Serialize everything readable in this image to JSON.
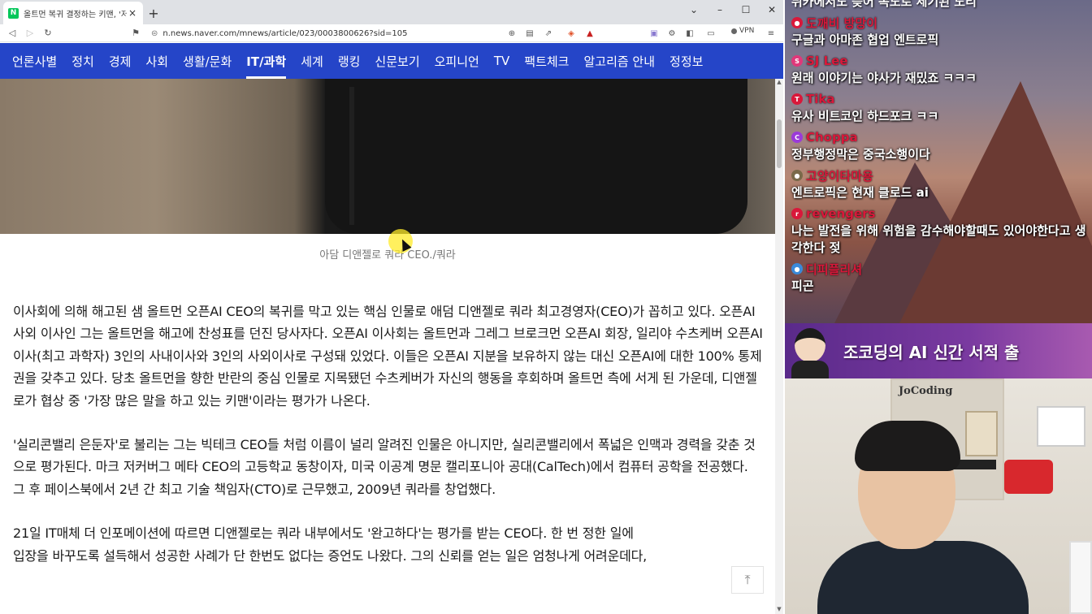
{
  "browser": {
    "tab": {
      "favicon": "N",
      "title": "올트먼 복귀 결정하는 키맨, '저커",
      "close_icon": "×"
    },
    "new_tab_icon": "+",
    "window_controls": [
      "⌄",
      "–",
      "☐",
      "✕"
    ],
    "url": "n.news.naver.com/mnews/article/023/0003800626?sid=105",
    "vpn_label": "VPN"
  },
  "naver_nav": {
    "items": [
      "언론사별",
      "정치",
      "경제",
      "사회",
      "생활/문화",
      "IT/과학",
      "세계",
      "랭킹",
      "신문보기",
      "오피니언",
      "TV",
      "팩트체크",
      "알고리즘 안내",
      "정정보"
    ],
    "active": "IT/과학"
  },
  "article": {
    "caption": "아담 디앤젤로 쿼라 CEO./쿼라",
    "paragraphs": [
      "이사회에 의해 해고된 샘 올트먼 오픈AI CEO의 복귀를 막고 있는 핵심 인물로 애덤 디앤젤로 쿼라 최고경영자(CEO)가 꼽히고 있다. 오픈AI 사외 이사인 그는 올트먼을 해고에 찬성표를 던진 당사자다. 오픈AI 이사회는 올트먼과 그레그 브로크먼 오픈AI 회장, 일리야 수츠케버 오픈AI 이사(최고 과학자) 3인의 사내이사와 3인의 사외이사로 구성돼 있었다. 이들은 오픈AI 지분을 보유하지 않는 대신 오픈AI에 대한 100% 통제권을 갖추고 있다. 당초 올트먼을 향한 반란의 중심 인물로 지목됐던 수츠케버가 자신의 행동을 후회하며 올트먼 측에 서게 된 가운데, 디앤젤로가 협상 중 '가장 많은 말을 하고 있는 키맨'이라는 평가가 나온다.",
      "'실리콘밸리 은둔자'로 불리는 그는 빅테크 CEO들 처럼 이름이 널리 알려진 인물은 아니지만, 실리콘밸리에서 폭넓은 인맥과 경력을 갖춘 것으로 평가된다. 마크 저커버그 메타 CEO의 고등학교 동창이자, 미국 이공계 명문 캘리포니아 공대(CalTech)에서 컴퓨터 공학을 전공했다. 그 후 페이스북에서 2년 간 최고 기술 책임자(CTO)로 근무했고, 2009년 쿼라를 창업했다.",
      "21일 IT매체 더 인포메이션에 따르면 디앤젤로는 쿼라 내부에서도 '완고하다'는 평가를 받는 CEO다. 한 번 정한 일에",
      "입장을 바꾸도록 설득해서 성공한 사례가 단 한번도 없다는 증언도 나왔다. 그의 신뢰를 얻는 일은 엄청나게 어려운데다,"
    ],
    "to_top_icon": "⤒"
  },
  "stream": {
    "chat_top_cut": "뒤카에서도 늦어 목도로 세기된 노리",
    "chat": [
      {
        "name": "도깨비 방망이",
        "text": "구글과 아마존 협업 엔트로픽",
        "avatar_color": "#d9183a"
      },
      {
        "name": "SJ Lee",
        "text": "원래 이야기는 야사가 재밌죠 ㅋㅋㅋ",
        "avatar_color": "#e0387a"
      },
      {
        "name": "Tika",
        "text": "유사 비트코인 하드포크 ㅋㅋ",
        "avatar_color": "#d9183a"
      },
      {
        "name": "Choppa",
        "text": "정부행정막은 중국소행이다",
        "avatar_color": "#9b3ad9"
      },
      {
        "name": "고양이타마용",
        "text": "엔트로픽은 현재 클로드 ai",
        "avatar_color": "#7a6a4a"
      },
      {
        "name": "revengers",
        "text": "나는 발전을 위해 위험을 감수해야할때도 있어야한다고 생각한다 젖",
        "avatar_color": "#d9183a"
      },
      {
        "name": "디피플리셔",
        "text": "피곤",
        "avatar_color": "#3a8ad9"
      }
    ],
    "banner_text": "조코딩의 AI 신간 서적 출",
    "webcam_logo": "JoCoding"
  },
  "colors": {
    "naver_blue": "#2545c8",
    "chat_name_red": "#d9183a",
    "banner_purple": "#5a2a8a"
  }
}
